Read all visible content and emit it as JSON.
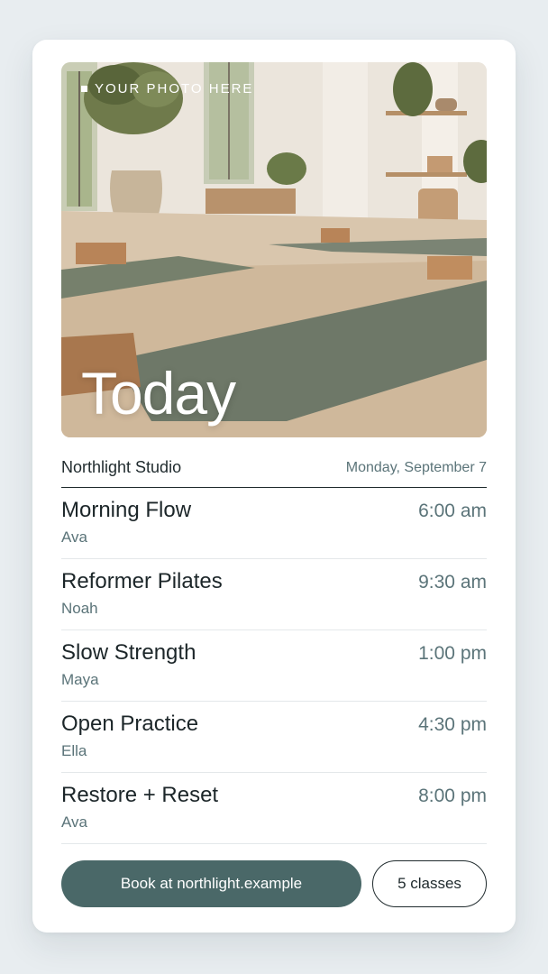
{
  "hero": {
    "photo_label": "YOUR PHOTO HERE",
    "title": "Today"
  },
  "header": {
    "studio": "Northlight Studio",
    "date": "Monday, September 7"
  },
  "classes": [
    {
      "name": "Morning Flow",
      "teacher": "Ava",
      "time": "6:00 am"
    },
    {
      "name": "Reformer Pilates",
      "teacher": "Noah",
      "time": "9:30 am"
    },
    {
      "name": "Slow Strength",
      "teacher": "Maya",
      "time": "1:00 pm"
    },
    {
      "name": "Open Practice",
      "teacher": "Ella",
      "time": "4:30 pm"
    },
    {
      "name": "Restore + Reset",
      "teacher": "Ava",
      "time": "8:00 pm"
    }
  ],
  "actions": {
    "book_label": "Book at northlight.example",
    "count_label": "5 classes"
  },
  "colors": {
    "accent": "#4a6868",
    "text": "#1c2629",
    "muted": "#5b7479",
    "background": "#e8edf0"
  }
}
